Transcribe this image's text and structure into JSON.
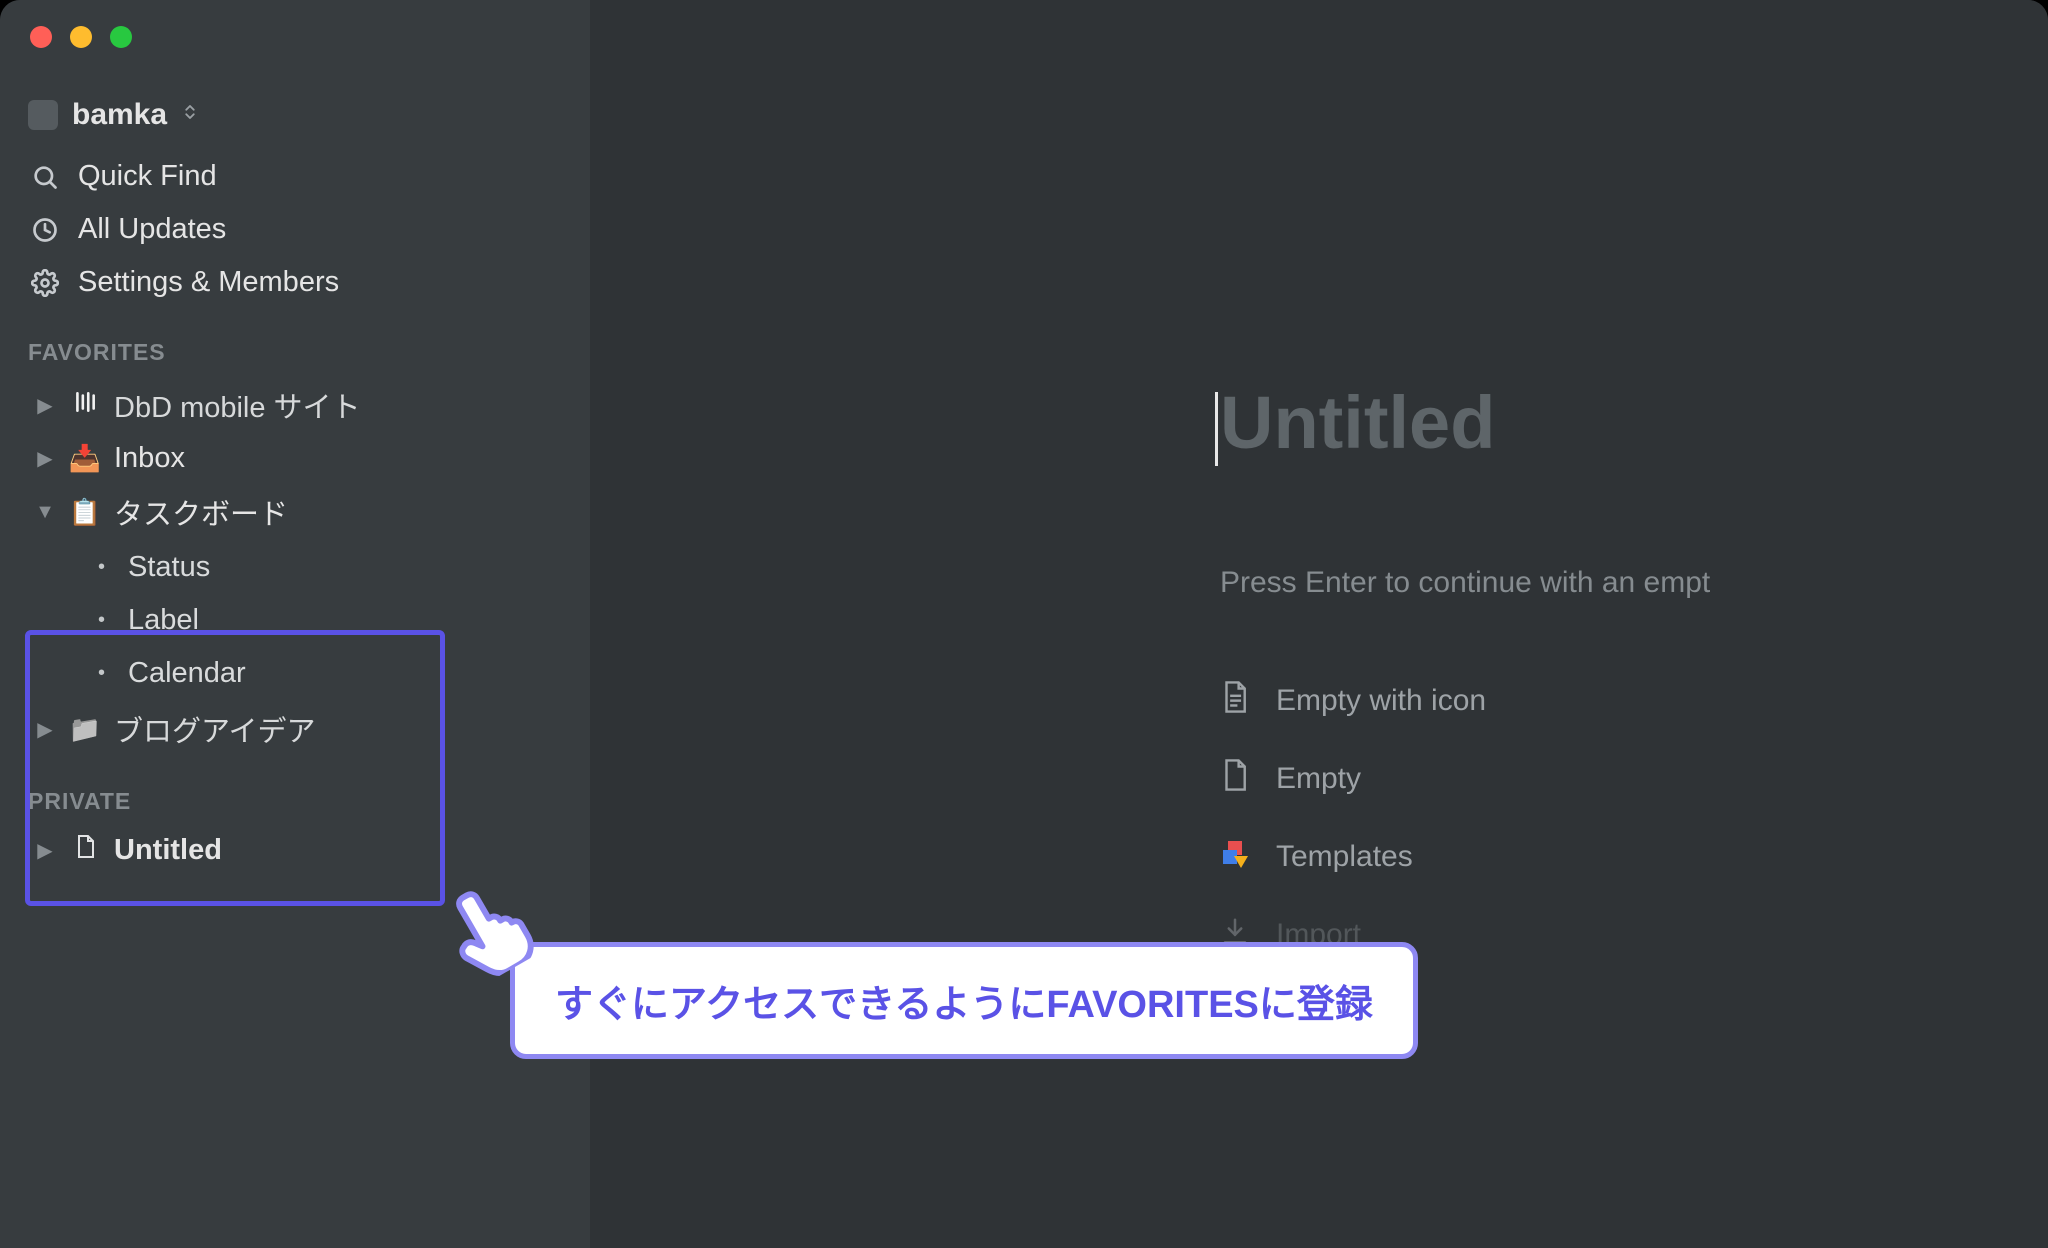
{
  "workspace": {
    "name": "bamka"
  },
  "sidebar": {
    "quick_find": "Quick Find",
    "all_updates": "All Updates",
    "settings_members": "Settings & Members",
    "sections": {
      "favorites": {
        "label": "FAVORITES",
        "items": [
          {
            "emoji": "dbd-icon",
            "label": "DbD mobile サイト",
            "expanded": false,
            "class": "w-light"
          },
          {
            "emoji": "📥",
            "label": "Inbox",
            "expanded": false
          },
          {
            "emoji": "📋",
            "label": "タスクボード",
            "expanded": true,
            "children": [
              "Status",
              "Label",
              "Calendar"
            ]
          },
          {
            "emoji": "📁",
            "label": "ブログアイデア",
            "expanded": false,
            "muted": true,
            "class": "w-light"
          }
        ]
      },
      "private": {
        "label": "PRIVATE",
        "items": [
          {
            "emoji": "page-icon",
            "label": "Untitled",
            "expanded": false,
            "bold": true
          }
        ]
      }
    }
  },
  "callout": {
    "text": "すぐにアクセスできるようにFAVORITESに登録"
  },
  "page": {
    "title_placeholder": "Untitled",
    "hint": "Press Enter to continue with an empt",
    "templates": [
      {
        "icon": "page-lines-icon",
        "label": "Empty with icon"
      },
      {
        "icon": "page-icon",
        "label": "Empty"
      },
      {
        "icon": "templates-icon",
        "label": "Templates"
      },
      {
        "icon": "import-icon",
        "label": "Import"
      }
    ]
  }
}
